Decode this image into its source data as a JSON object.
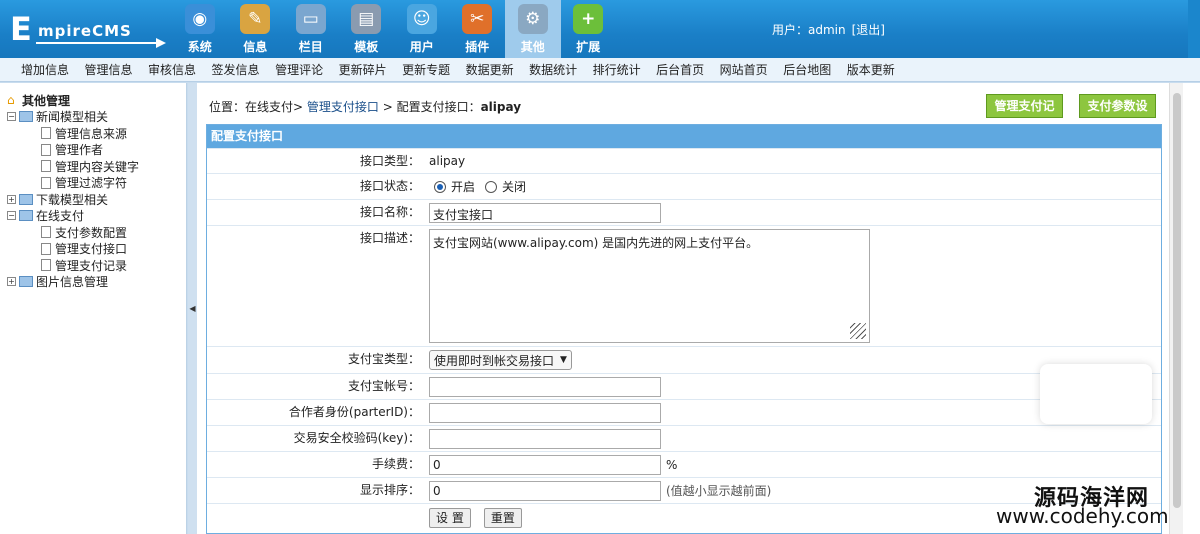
{
  "logo": {
    "big": "E",
    "rest": "mpireCMS"
  },
  "topnav": [
    {
      "label": "系统",
      "icon": "globe-icon",
      "color": "#3a8fd8",
      "glyph": "◉"
    },
    {
      "label": "信息",
      "icon": "edit-document-icon",
      "color": "#d9a441",
      "glyph": "✎"
    },
    {
      "label": "栏目",
      "icon": "folder-icon",
      "color": "#7aa6cf",
      "glyph": "▭"
    },
    {
      "label": "模板",
      "icon": "template-window-icon",
      "color": "#8a9bb0",
      "glyph": "▤"
    },
    {
      "label": "用户",
      "icon": "user-icon",
      "color": "#4aa6e0",
      "glyph": "☺"
    },
    {
      "label": "插件",
      "icon": "tools-icon",
      "color": "#e0702a",
      "glyph": "✂"
    },
    {
      "label": "其他",
      "icon": "gear-icon",
      "color": "#8aa8c2",
      "glyph": "⚙"
    },
    {
      "label": "扩展",
      "icon": "plus-icon",
      "color": "#6cbf3a",
      "glyph": "+"
    }
  ],
  "topnav_active": "其他",
  "user": {
    "text": "用户：admin",
    "logout": "[退出]"
  },
  "menubar": [
    "增加信息",
    "管理信息",
    "审核信息",
    "签发信息",
    "管理评论",
    "更新碎片",
    "更新专题",
    "数据更新",
    "数据统计",
    "排行统计",
    "后台首页",
    "网站首页",
    "后台地图",
    "版本更新"
  ],
  "sidebar": {
    "root": "其他管理",
    "nodes": [
      {
        "label": "新闻模型相关",
        "type": "folder",
        "expanded": true
      },
      {
        "label": "管理信息来源",
        "type": "doc"
      },
      {
        "label": "管理作者",
        "type": "doc"
      },
      {
        "label": "管理内容关键字",
        "type": "doc"
      },
      {
        "label": "管理过滤字符",
        "type": "doc"
      },
      {
        "label": "下载模型相关",
        "type": "folder",
        "expanded": false
      },
      {
        "label": "在线支付",
        "type": "folder",
        "expanded": true
      },
      {
        "label": "支付参数配置",
        "type": "doc"
      },
      {
        "label": "管理支付接口",
        "type": "doc"
      },
      {
        "label": "管理支付记录",
        "type": "doc"
      },
      {
        "label": "图片信息管理",
        "type": "folder",
        "expanded": false
      }
    ]
  },
  "breadcrumb": {
    "prefix": "位置：在线支付> ",
    "link": "管理支付接口",
    "sep": " > 配置支付接口：",
    "current": "alipay"
  },
  "buttons": {
    "records": "管理支付记录",
    "settings": "支付参数设置"
  },
  "form": {
    "title": "配置支付接口",
    "type_label": "接口类型：",
    "type_value": "alipay",
    "status_label": "接口状态：",
    "status_on": "开启",
    "status_off": "关闭",
    "name_label": "接口名称：",
    "name_value": "支付宝接口",
    "desc_label": "接口描述：",
    "desc_value": "支付宝网站(www.alipay.com) 是国内先进的网上支付平台。",
    "alipay_type_label": "支付宝类型：",
    "alipay_type_value": "使用即时到帐交易接口",
    "account_label": "支付宝帐号：",
    "account_value": "",
    "partner_label": "合作者身份(parterID)：",
    "partner_value": "",
    "key_label": "交易安全校验码(key)：",
    "key_value": "",
    "fee_label": "手续费：",
    "fee_value": "0",
    "fee_unit": "%",
    "order_label": "显示排序：",
    "order_value": "0",
    "order_note": "(值越小显示越前面)",
    "submit": "设 置",
    "reset": "重置"
  },
  "watermark": {
    "line1": "源码海洋网",
    "line2": "www.codehy.com"
  }
}
